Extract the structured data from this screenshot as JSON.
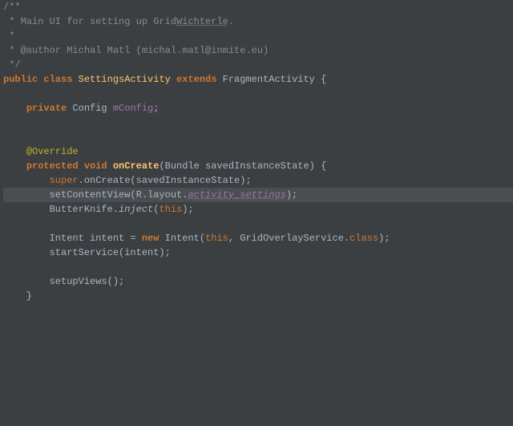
{
  "lines": [
    {
      "cls": "line",
      "spans": [
        {
          "c": "doccomment",
          "t": "/**"
        }
      ]
    },
    {
      "cls": "line",
      "spans": [
        {
          "c": "doccomment",
          "t": " * Main UI for setting up Grid"
        },
        {
          "c": "doccomment ul",
          "t": "Wichterle"
        },
        {
          "c": "doccomment",
          "t": "."
        }
      ]
    },
    {
      "cls": "line",
      "spans": [
        {
          "c": "doccomment",
          "t": " *"
        }
      ]
    },
    {
      "cls": "line",
      "spans": [
        {
          "c": "doccomment",
          "t": " * @author Michal Matl (michal.matl@inmite.eu)"
        }
      ]
    },
    {
      "cls": "line",
      "spans": [
        {
          "c": "doccomment",
          "t": " */"
        }
      ]
    },
    {
      "cls": "line",
      "spans": [
        {
          "c": "kw",
          "t": "public class "
        },
        {
          "c": "cls",
          "t": "SettingsActivity "
        },
        {
          "c": "kw",
          "t": "extends "
        },
        {
          "c": "",
          "t": "FragmentActivity {"
        }
      ]
    },
    {
      "cls": "line",
      "spans": [
        {
          "c": "",
          "t": ""
        }
      ]
    },
    {
      "cls": "line",
      "spans": [
        {
          "c": "",
          "t": "    "
        },
        {
          "c": "kw",
          "t": "private "
        },
        {
          "c": "",
          "t": "Config "
        },
        {
          "c": "obj",
          "t": "mConfig"
        },
        {
          "c": "",
          "t": ";"
        }
      ]
    },
    {
      "cls": "line",
      "spans": [
        {
          "c": "",
          "t": ""
        }
      ]
    },
    {
      "cls": "line",
      "spans": [
        {
          "c": "",
          "t": ""
        }
      ]
    },
    {
      "cls": "line",
      "spans": [
        {
          "c": "",
          "t": "    "
        },
        {
          "c": "annotation",
          "t": "@Override"
        }
      ]
    },
    {
      "cls": "line",
      "spans": [
        {
          "c": "",
          "t": "    "
        },
        {
          "c": "kw",
          "t": "protected void "
        },
        {
          "c": "mname",
          "t": "onCreate"
        },
        {
          "c": "",
          "t": "(Bundle savedInstanceState) {"
        }
      ]
    },
    {
      "cls": "line",
      "spans": [
        {
          "c": "",
          "t": "        "
        },
        {
          "c": "kw2",
          "t": "super"
        },
        {
          "c": "",
          "t": ".onCreate(savedInstanceState);"
        }
      ]
    },
    {
      "cls": "line hl",
      "spans": [
        {
          "c": "",
          "t": "        setContentView(R.layout."
        },
        {
          "c": "obj italic ul",
          "t": "activity_settings"
        },
        {
          "c": "",
          "t": ");"
        }
      ]
    },
    {
      "cls": "line",
      "spans": [
        {
          "c": "",
          "t": "        ButterKnife."
        },
        {
          "c": "italic",
          "t": "inject"
        },
        {
          "c": "",
          "t": "("
        },
        {
          "c": "kw2",
          "t": "this"
        },
        {
          "c": "",
          "t": ");"
        }
      ]
    },
    {
      "cls": "line",
      "spans": [
        {
          "c": "",
          "t": ""
        }
      ]
    },
    {
      "cls": "line",
      "spans": [
        {
          "c": "",
          "t": "        Intent intent = "
        },
        {
          "c": "kw",
          "t": "new "
        },
        {
          "c": "",
          "t": "Intent("
        },
        {
          "c": "kw2",
          "t": "this"
        },
        {
          "c": "",
          "t": ", GridOverlayService."
        },
        {
          "c": "kw2",
          "t": "class"
        },
        {
          "c": "",
          "t": ");"
        }
      ]
    },
    {
      "cls": "line",
      "spans": [
        {
          "c": "",
          "t": "        startService(intent);"
        }
      ]
    },
    {
      "cls": "line",
      "spans": [
        {
          "c": "",
          "t": ""
        }
      ]
    },
    {
      "cls": "line",
      "spans": [
        {
          "c": "",
          "t": "        setupViews();"
        }
      ]
    },
    {
      "cls": "line",
      "spans": [
        {
          "c": "",
          "t": "    }"
        }
      ]
    }
  ]
}
